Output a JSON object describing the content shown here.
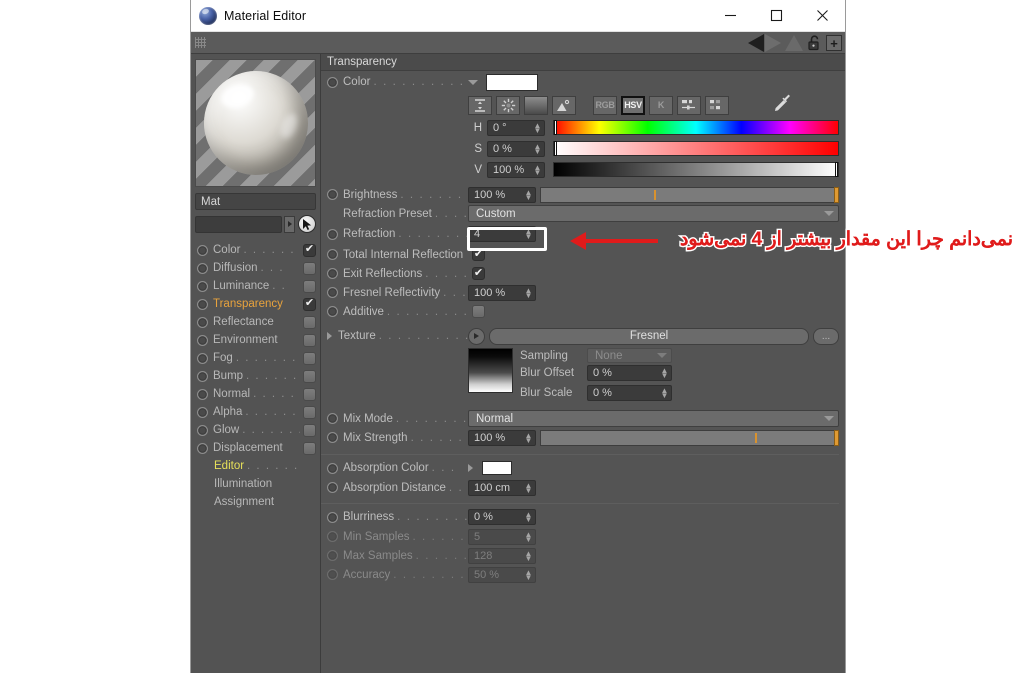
{
  "window": {
    "title": "Material Editor",
    "icon": "cinema4d-sphere-icon",
    "minimize": "—",
    "maximize": "□",
    "close": "✕"
  },
  "toolbar": {
    "grip": "drag-grip",
    "prev_icon": "triangle-left-icon",
    "next_icon": "triangle-up-icon",
    "lock_icon": "unlock-icon",
    "add_icon": "+"
  },
  "left_panel": {
    "material_name": "Mat",
    "search_value": "",
    "search_arrow": "▸",
    "cursor_icon": "pointer-arrow-icon",
    "channels": [
      {
        "label": "Color",
        "dots": ". . . . . .",
        "checked": true,
        "state": "normal"
      },
      {
        "label": "Diffusion",
        "dots": ". . .",
        "checked": false,
        "state": "normal"
      },
      {
        "label": "Luminance",
        "dots": ". .",
        "checked": false,
        "state": "normal"
      },
      {
        "label": "Transparency",
        "dots": "",
        "checked": true,
        "state": "active"
      },
      {
        "label": "Reflectance",
        "dots": "",
        "checked": false,
        "state": "normal"
      },
      {
        "label": "Environment",
        "dots": "",
        "checked": false,
        "state": "normal"
      },
      {
        "label": "Fog",
        "dots": ". . . . . . . .",
        "checked": false,
        "state": "normal"
      },
      {
        "label": "Bump",
        "dots": ". . . . . .",
        "checked": false,
        "state": "normal"
      },
      {
        "label": "Normal",
        "dots": ". . . . .",
        "checked": false,
        "state": "normal"
      },
      {
        "label": "Alpha",
        "dots": ". . . . . .",
        "checked": false,
        "state": "normal"
      },
      {
        "label": "Glow",
        "dots": ". . . . . . .",
        "checked": false,
        "state": "normal"
      },
      {
        "label": "Displacement",
        "dots": "",
        "checked": false,
        "state": "normal"
      }
    ],
    "sub_items": [
      {
        "label": "Editor",
        "dots": ". . . . . .",
        "state": "editor"
      },
      {
        "label": "Illumination",
        "dots": "",
        "state": "plain"
      },
      {
        "label": "Assignment",
        "dots": "",
        "state": "plain"
      }
    ]
  },
  "main": {
    "section_title": "Transparency",
    "color": {
      "label": "Color",
      "dots": ". . . . . . . . . . . .",
      "expand_icon": "chevron-down-icon",
      "swatch_hex": "#ffffff",
      "mode_buttons": [
        {
          "name": "range-icon",
          "label": "",
          "selected": false
        },
        {
          "name": "wheel-icon",
          "label": "",
          "selected": false
        },
        {
          "name": "gradient-icon",
          "label": "",
          "selected": false
        },
        {
          "name": "image-icon",
          "label": "",
          "selected": false
        },
        {
          "name": "rgb-mode",
          "label": "RGB",
          "selected": false
        },
        {
          "name": "hsv-mode",
          "label": "HSV",
          "selected": true
        },
        {
          "name": "kelvin-mode",
          "label": "K",
          "selected": false
        },
        {
          "name": "mixer-icon",
          "label": "",
          "selected": false
        },
        {
          "name": "swatches-icon",
          "label": "",
          "selected": false
        },
        {
          "name": "eyedropper-icon",
          "label": "",
          "selected": false
        }
      ],
      "hsv": [
        {
          "letter": "H",
          "value": "0 °",
          "knob_pct": 0
        },
        {
          "letter": "S",
          "value": "0 %",
          "knob_pct": 0
        },
        {
          "letter": "V",
          "value": "100 %",
          "knob_pct": 100
        }
      ]
    },
    "brightness": {
      "label": "Brightness",
      "dots": ". . . . . . . . . .",
      "value": "100 %",
      "tick_pct": 38,
      "handle_pct": 100
    },
    "refraction_preset": {
      "label": "Refraction Preset",
      "dots": ". . . . . .",
      "value": "Custom"
    },
    "refraction": {
      "label": "Refraction",
      "dots": ". . . . . . . . . .",
      "value": "4",
      "highlighted": true
    },
    "total_internal_reflection": {
      "label": "Total Internal Reflection",
      "dots": "",
      "checked": true
    },
    "exit_reflections": {
      "label": "Exit Reflections",
      "dots": ". . . . . . .",
      "checked": true
    },
    "fresnel_reflectivity": {
      "label": "Fresnel Reflectivity",
      "dots": ". . . .",
      "value": "100 %"
    },
    "additive": {
      "label": "Additive",
      "dots": ". . . . . . . . . . . .",
      "checked": false
    },
    "texture": {
      "label": "Texture",
      "dots": ". . . . . . . . . . . .",
      "expand_icon": "triangle-right-icon",
      "play_icon": "triangle-right-icon",
      "value": "Fresnel",
      "more_label": "...",
      "thumbnail": "black-to-white-gradient",
      "sampling": {
        "label": "Sampling",
        "value": "None",
        "disabled": true
      },
      "blur_offset": {
        "label": "Blur Offset",
        "value": "0 %"
      },
      "blur_scale": {
        "label": "Blur Scale",
        "value": "0 %"
      }
    },
    "mix_mode": {
      "label": "Mix Mode",
      "dots": ". . . . . . . . . .",
      "value": "Normal"
    },
    "mix_strength": {
      "label": "Mix Strength",
      "dots": ". . . . . . . . .",
      "value": "100 %",
      "tick_pct": 72,
      "handle_pct": 100
    },
    "absorption_color": {
      "label": "Absorption Color",
      "dots": ". . .",
      "expand_icon": "triangle-right-icon",
      "swatch_hex": "#ffffff"
    },
    "absorption_distance": {
      "label": "Absorption Distance",
      "dots": ". . .",
      "value": "100 cm"
    },
    "blurriness": {
      "label": "Blurriness",
      "dots": ". . . . . . . . . . .",
      "value": "0 %",
      "disabled": false
    },
    "min_samples": {
      "label": "Min Samples",
      "dots": ". . . . . . . . .",
      "value": "5",
      "disabled": true
    },
    "max_samples": {
      "label": "Max Samples",
      "dots": ". . . . . . . . .",
      "value": "128",
      "disabled": true
    },
    "accuracy": {
      "label": "Accuracy",
      "dots": ". . . . . . . . . . . .",
      "value": "50 %",
      "disabled": true
    }
  },
  "annotation": {
    "text": "نمی‌دانم چرا این مقدار بیشتر از 4 نمی‌شود",
    "arrow": "red-left-arrow",
    "color": "#e01b1b",
    "outline_color": "#ffffff"
  }
}
